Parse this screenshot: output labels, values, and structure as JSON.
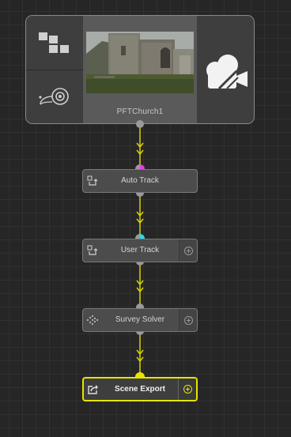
{
  "clip": {
    "name": "PFTChurch1"
  },
  "nodes": [
    {
      "label": "Auto Track",
      "icon": "auto-track-icon",
      "has_add": false
    },
    {
      "label": "User Track",
      "icon": "user-track-icon",
      "has_add": true
    },
    {
      "label": "Survey Solver",
      "icon": "survey-solver-icon",
      "has_add": true
    },
    {
      "label": "Scene Export",
      "icon": "export-icon",
      "has_add": true,
      "selected": true
    }
  ],
  "colors": {
    "background": "#262626",
    "wire": "#e8e400",
    "selected": "#e8e400",
    "port": "#9a9a9a",
    "port_magenta": "#e040e0",
    "port_cyan": "#30d8e8"
  }
}
